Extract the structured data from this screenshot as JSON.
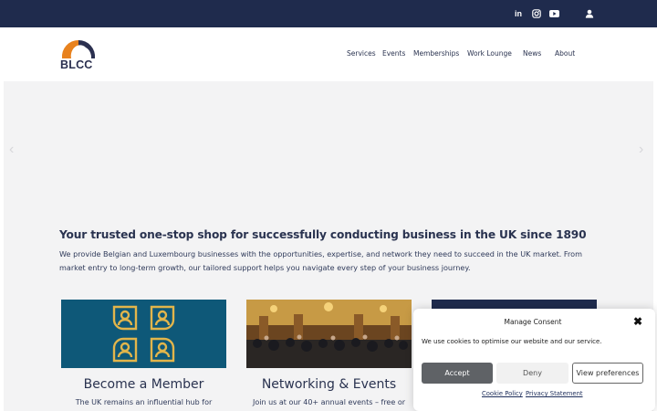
{
  "topbar": {
    "icons": [
      "linkedin-icon",
      "instagram-icon",
      "youtube-icon",
      "user-icon"
    ],
    "linkedin_glyph": "in"
  },
  "brand": {
    "logo_text": "BLCC",
    "colors": {
      "navy": "#1f2b4d",
      "orange": "#e8821e",
      "card_teal": "#0e5878"
    }
  },
  "nav": {
    "items": [
      "Services",
      "Events",
      "Memberships",
      "Work Lounge",
      "News",
      "About"
    ]
  },
  "hero": {
    "prev_arrow": "‹",
    "next_arrow": "›"
  },
  "intro": {
    "headline": "Your trusted one-stop shop for successfully conducting business in the UK since 1890",
    "body": "We provide Belgian and Luxembourg businesses with the opportunities, expertise, and network they need to succeed in the UK market. From market entry to long-term growth, our tailored support helps you navigate every step of your business journey."
  },
  "cards": [
    {
      "title": "Become a Member",
      "text": "The UK remains an influential hub for"
    },
    {
      "title": "Networking & Events",
      "text": "Join us at our 40+ annual events – free or"
    },
    {
      "title": "",
      "text": ""
    }
  ],
  "consent": {
    "title": "Manage Consent",
    "message": "We use cookies to optimise our website and our service.",
    "accept": "Accept",
    "deny": "Deny",
    "preferences": "View preferences",
    "cookie_policy": "Cookie Policy",
    "privacy": "Privacy Statement",
    "close": "✖"
  }
}
